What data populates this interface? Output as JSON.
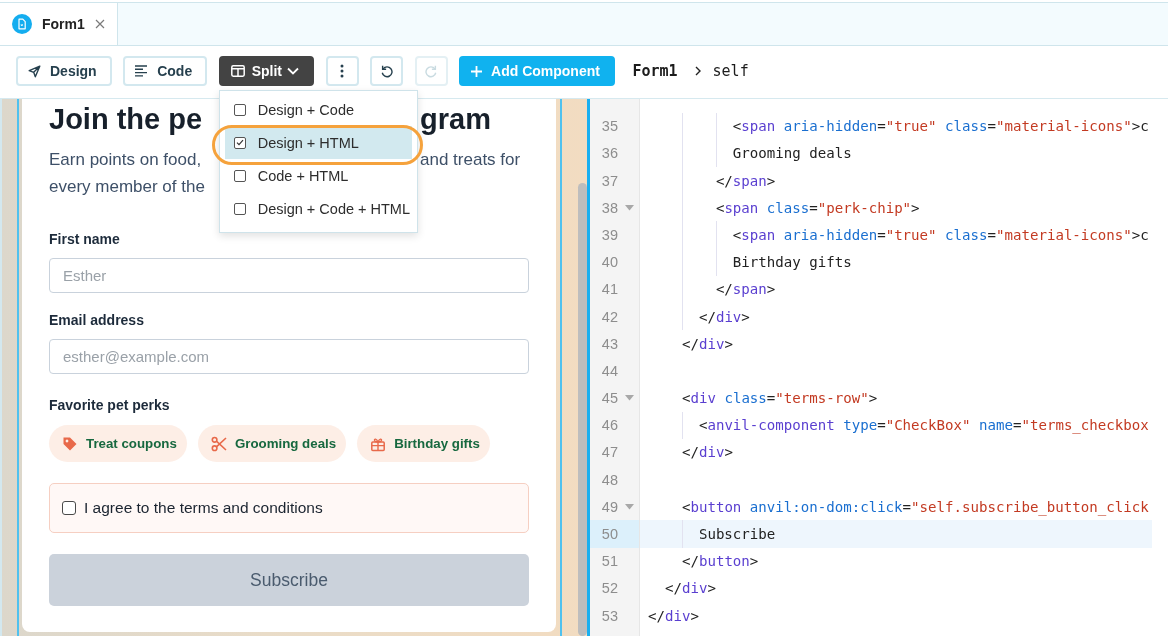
{
  "tabs": [
    {
      "label": "Form1",
      "selected": true
    }
  ],
  "toolbar": {
    "view_buttons": [
      {
        "label": "Design",
        "selected": false
      },
      {
        "label": "Code",
        "selected": false
      },
      {
        "label": "Split",
        "selected": true,
        "menu": {
          "expanded": true,
          "items": [
            {
              "label": "Design + Code",
              "checked": false,
              "selected": false,
              "circled": false
            },
            {
              "label": "Design + HTML",
              "checked": true,
              "selected": true,
              "circled": true
            },
            {
              "label": "Code + HTML",
              "checked": false,
              "selected": false,
              "circled": false
            },
            {
              "label": "Design + Code + HTML",
              "checked": false,
              "selected": false,
              "circled": false
            }
          ]
        }
      }
    ],
    "icon_buttons": [
      {
        "disabled": false
      },
      {
        "disabled": false
      },
      {
        "disabled": true
      }
    ],
    "add_button": {
      "label": "Add Component"
    },
    "breadcrumb": [
      "Form1",
      "self"
    ]
  },
  "design_canvas": {
    "form": {
      "heading_parts": [
        "Join the pe",
        "gram"
      ],
      "description_lines": [
        [
          "Earn points on food,",
          "and treats for"
        ],
        [
          "every member of the"
        ]
      ],
      "fields": [
        {
          "label": "First name",
          "placeholder": "Esther"
        },
        {
          "label": "Email address",
          "placeholder": "esther@example.com"
        }
      ],
      "perks_label": "Favorite pet perks",
      "perks": [
        "Treat coupons",
        "Grooming deals",
        "Birthday gifts"
      ],
      "terms": {
        "label": "I agree to the terms and conditions",
        "checked": false
      },
      "submit": {
        "label": "Subscribe",
        "disabled": true
      }
    }
  },
  "code_editor": {
    "lines": [
      {
        "children": [
          {
            "children": [
              {
                "children": [
                  {
                    "children": [
                      {
                        "children": [
                          {
                            "number": "35",
                            "code": "<span aria-hidden=\"true\" class=\"material-icons\">c",
                            "active": false
                          },
                          {
                            "number": "36",
                            "code": "Grooming deals",
                            "active": false
                          }
                        ]
                      },
                      {
                        "number": "37",
                        "code": "</span>",
                        "active": false
                      },
                      {
                        "number": "38",
                        "code": "<span class=\"perk-chip\">",
                        "expanded": true,
                        "active": false,
                        "children": [
                          {
                            "number": "39",
                            "code": "<span aria-hidden=\"true\" class=\"material-icons\">c",
                            "active": false
                          },
                          {
                            "number": "40",
                            "code": "Birthday gifts",
                            "active": false
                          }
                        ]
                      },
                      {
                        "number": "41",
                        "code": "</span>",
                        "active": false
                      }
                    ]
                  },
                  {
                    "number": "42",
                    "code": "</div>",
                    "active": false
                  }
                ]
              },
              {
                "number": "43",
                "code": "</div>",
                "active": false
              },
              {
                "number": "44",
                "active": false
              },
              {
                "number": "45",
                "code": "<div class=\"terms-row\">",
                "expanded": true,
                "active": false,
                "children": [
                  {
                    "number": "46",
                    "code": "<anvil-component type=\"CheckBox\" name=\"terms_checkbox",
                    "active": false
                  }
                ]
              },
              {
                "number": "47",
                "code": "</div>",
                "active": false
              },
              {
                "number": "48",
                "active": false
              },
              {
                "number": "49",
                "code": "<button anvil:on-dom:click=\"self.subscribe_button_click",
                "expanded": true,
                "active": false,
                "children": [
                  {
                    "number": "50",
                    "code": "Subscribe",
                    "active": true
                  }
                ]
              },
              {
                "number": "51",
                "code": "</button>",
                "active": false
              }
            ]
          },
          {
            "number": "52",
            "code": "</div>",
            "active": false
          }
        ]
      },
      {
        "number": "53",
        "code": "</div>",
        "active": false
      }
    ]
  }
}
